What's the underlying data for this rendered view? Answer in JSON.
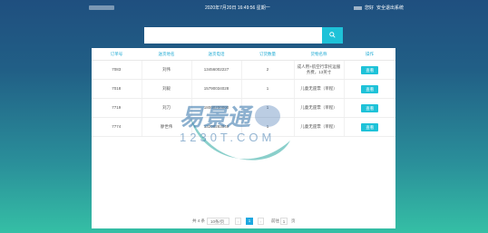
{
  "header": {
    "datetime": "2020年7月20日 16:49:56 星期一",
    "greeting": "您好",
    "logout": "安全退出系统"
  },
  "search": {
    "placeholder": "",
    "button_icon": "search-icon"
  },
  "table": {
    "columns": [
      "订单号",
      "送货地名",
      "送货电话",
      "订货数量",
      "货物名称",
      "操作"
    ],
    "rows": [
      {
        "order": "7083",
        "name": "刘伟",
        "phone": "13456002227",
        "qty": "2",
        "goods": "成人用+航空行李托运服务费，13英寸",
        "action": "查看"
      },
      {
        "order": "7018",
        "name": "刘毅",
        "phone": "15790034028",
        "qty": "1",
        "goods": "儿童无座票（单程）",
        "action": "查看"
      },
      {
        "order": "7719",
        "name": "刘刀",
        "phone": "18000200000",
        "qty": "1",
        "goods": "儿童无座票（单程）",
        "action": "查看"
      },
      {
        "order": "7774",
        "name": "廖世伟",
        "phone": "13200283049",
        "qty": "1",
        "goods": "儿童无座票（单程）",
        "action": "查看"
      }
    ]
  },
  "pager": {
    "total": "共 4 条",
    "page_size": "10条/页",
    "prev": "‹",
    "current": "1",
    "next": "›",
    "goto_label": "前往",
    "goto_value": "1",
    "page_suffix": "页"
  },
  "watermark": {
    "brand": "易景通",
    "domain": "1230T.COM"
  },
  "colors": {
    "accent": "#1ec2d8",
    "header_text": "#1eaad3",
    "pager_active": "#1ea8e0"
  }
}
